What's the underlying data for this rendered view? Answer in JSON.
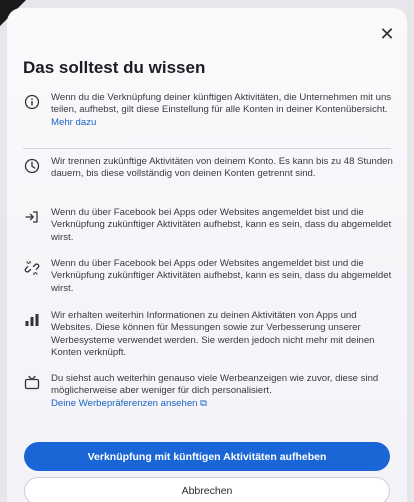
{
  "dialog": {
    "title": "Das solltest du wissen",
    "close_label": "✕"
  },
  "items": [
    {
      "icon": "info-icon",
      "text": "Wenn du die Verknüpfung deiner künftigen Aktivitäten, die Unternehmen mit uns teilen, aufhebst, gilt diese Einstellung für alle Konten in deiner Kontenübersicht.",
      "link": "Mehr dazu"
    },
    {
      "icon": "clock-icon",
      "text": "Wir trennen zukünftige Aktivitäten von deinem Konto. Es kann bis zu 48 Stunden dauern, bis diese vollständig von deinen Konten getrennt sind."
    },
    {
      "icon": "login-arrow-icon",
      "text": "Wenn du über Facebook bei Apps oder Websites angemeldet bist und die Verknüpfung zukünftiger Aktivitäten aufhebst, kann es sein, dass du abgemeldet wirst."
    },
    {
      "icon": "unlink-icon",
      "text": "Wenn du über Facebook bei Apps oder Websites angemeldet bist und die Verknüpfung zukünftiger Aktivitäten aufhebst, kann es sein, dass du abgemeldet wirst."
    },
    {
      "icon": "bar-chart-icon",
      "text": "Wir erhalten weiterhin Informationen zu deinen Aktivitäten von Apps und Websites. Diese können für Messungen sowie zur Verbesserung unserer Werbesysteme verwendet werden. Sie werden jedoch nicht mehr mit deinen Konten verknüpft."
    },
    {
      "icon": "tv-icon",
      "text": "Du siehst auch weiterhin genauso viele Werbeanzeigen wie zuvor, diese sind möglicherweise aber weniger für dich personalisiert.",
      "link": "Deine Werbepräferenzen ansehen",
      "link_suffix": "⧉"
    }
  ],
  "buttons": {
    "primary": "Verknüpfung mit künftigen Aktivitäten aufheben",
    "secondary": "Abbrechen"
  },
  "colors": {
    "accent": "#1b66d6",
    "link": "#1a64c8"
  }
}
